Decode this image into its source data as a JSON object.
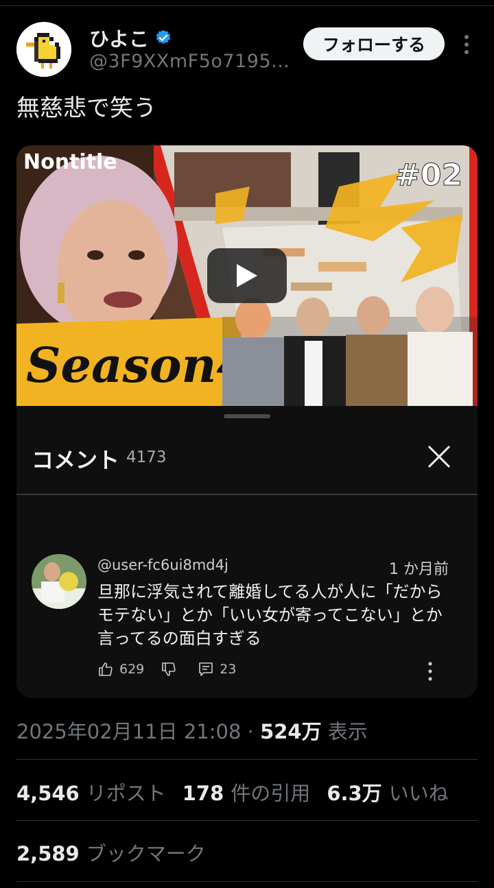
{
  "post": {
    "display_name": "ひよこ",
    "handle": "@3F9XXmF5o7195...",
    "follow_label": "フォローする",
    "text": "無慈悲で笑う"
  },
  "video": {
    "brand_text": "Nontitle",
    "episode": "#02",
    "season_text": "Season4"
  },
  "comments_panel": {
    "title": "コメント",
    "count": "4173",
    "comment": {
      "user": "@user-fc6ui8md4j",
      "time": "1 か月前",
      "text": "旦那に浮気されて離婚してる人が人に「だからモテない」とか「いい女が寄ってこない」とか言ってるの面白すぎる",
      "likes": "629",
      "replies": "23"
    }
  },
  "meta": {
    "date": "2025年02月11日 21:08",
    "dot": "·",
    "views": "524万",
    "views_label": "表示"
  },
  "stats": {
    "reposts": "4,546",
    "reposts_label": "リポスト",
    "quotes": "178",
    "quotes_label": "件の引用",
    "likes": "6.3万",
    "likes_label": "いいね",
    "bookmarks": "2,589",
    "bookmarks_label": "ブックマーク"
  },
  "colors": {
    "verified": "#1d9bf0",
    "accent_yellow": "#f2b322",
    "accent_red": "#d7261e"
  }
}
